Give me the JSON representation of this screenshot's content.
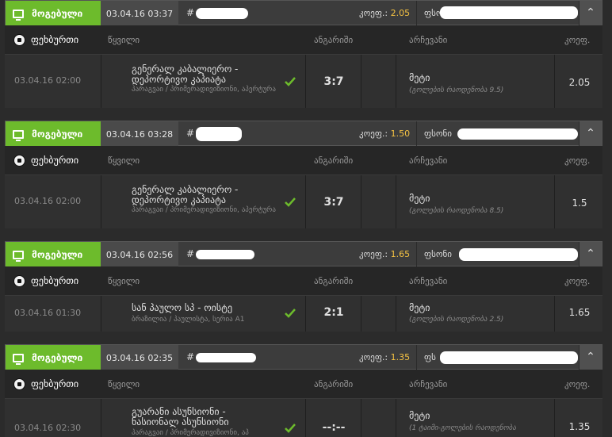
{
  "columns": {
    "event": "წყვილი",
    "score": "ანგარიში",
    "pick": "არჩევანი",
    "odds": "კოეფ."
  },
  "odds_prefix": "კოეფ.:",
  "colors": {
    "win": "#6dbb2c",
    "odds_value": "#f5c242"
  },
  "bets": [
    {
      "status": "მოგებული",
      "placed": "03.04.16 03:37",
      "hash": "#",
      "odds_total": "2.05",
      "stake_prefix": "ფსო",
      "sport": "ფეხბურთი",
      "time": "03.04.16 02:00",
      "event": "გენერალ კაბალიერო - დეპორტივო კაპიატა",
      "league": "პარაგვაი / პრიმერადივიზიონი, აპერტურა",
      "score": "3:7",
      "pick": "მეტი",
      "pick_detail": "(გოლების რაოდენობა 9.5)",
      "odd": "2.05"
    },
    {
      "status": "მოგებული",
      "placed": "03.04.16 03:28",
      "hash": "#",
      "odds_total": "1.50",
      "stake_prefix": "ფსონი",
      "sport": "ფეხბურთი",
      "time": "03.04.16 02:00",
      "event": "გენერალ კაბალიერო - დეპორტივო კაპიატა",
      "league": "პარაგვაი / პრიმერადივიზიონი, აპერტურა",
      "score": "3:7",
      "pick": "მეტი",
      "pick_detail": "(გოლების რაოდენობა 8.5)",
      "odd": "1.5"
    },
    {
      "status": "მოგებული",
      "placed": "03.04.16 02:56",
      "hash": "#",
      "odds_total": "1.65",
      "stake_prefix": "ფსონი",
      "sport": "ფეხბურთი",
      "time": "03.04.16 01:30",
      "event": "სან პაულო სპ - ოისტე",
      "league": "ბრაზილია / პაულისტა, სერია A1",
      "score": "2:1",
      "pick": "მეტი",
      "pick_detail": "(გოლების რაოდენობა 2.5)",
      "odd": "1.65"
    },
    {
      "status": "მოგებული",
      "placed": "03.04.16 02:35",
      "hash": "#",
      "odds_total": "1.35",
      "stake_prefix": "ფს",
      "sport": "ფეხბურთი",
      "time": "03.04.16 02:30",
      "event": "გუარანი ასუნსიონი - ნასიონალ ასუნსიონი",
      "league": "პარაგვაი / პრიმერადივიზიონი, აპ",
      "score": "--:--",
      "pick": "მეტი",
      "pick_detail": "(1 ტაიმი-გოლების რაოდენობა",
      "odd": "1.35"
    }
  ]
}
